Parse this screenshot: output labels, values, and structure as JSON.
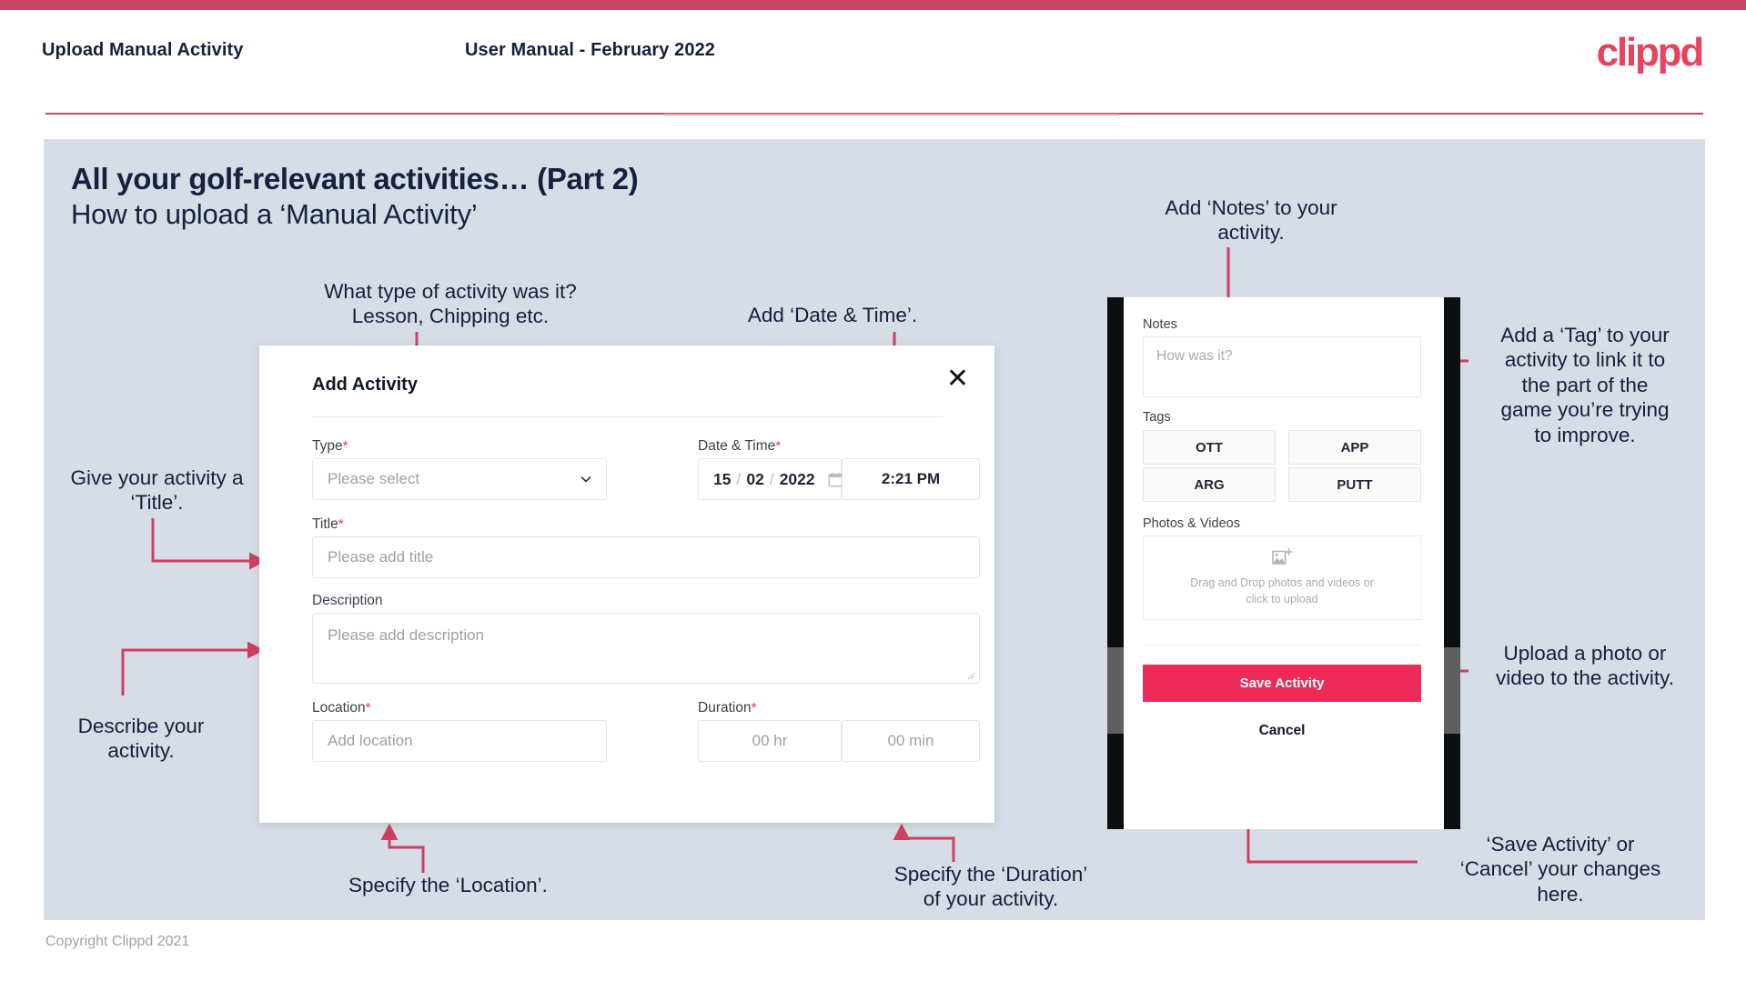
{
  "header": {
    "left_title": "Upload Manual Activity",
    "center_title": "User Manual - February 2022",
    "logo_text": "clippd"
  },
  "slide": {
    "title": "All your golf-relevant activities… (Part 2)",
    "subtitle": "How to upload a ‘Manual Activity’",
    "footer": "Copyright Clippd 2021"
  },
  "dialog": {
    "title": "Add Activity",
    "close_icon": "close-icon",
    "fields": {
      "type": {
        "label": "Type",
        "required": "*",
        "placeholder": "Please select",
        "chevron_icon": "chevron-down-icon"
      },
      "datetime": {
        "label": "Date & Time",
        "required": "*",
        "day": "15",
        "sep1": "/",
        "month": "02",
        "sep2": "/",
        "year": "2022",
        "calendar_icon": "calendar-icon",
        "time": "2:21 PM"
      },
      "title": {
        "label": "Title",
        "required": "*",
        "placeholder": "Please add title"
      },
      "description": {
        "label": "Description",
        "required": "",
        "placeholder": "Please add description"
      },
      "location": {
        "label": "Location",
        "required": "*",
        "placeholder": "Add location"
      },
      "duration": {
        "label": "Duration",
        "required": "*",
        "hours_placeholder": "00 hr",
        "minutes_placeholder": "00 min"
      }
    }
  },
  "phone": {
    "notes": {
      "label": "Notes",
      "placeholder": "How was it?"
    },
    "tags": {
      "label": "Tags",
      "items": [
        "OTT",
        "APP",
        "ARG",
        "PUTT"
      ]
    },
    "photos": {
      "label": "Photos & Videos",
      "upload_icon": "add-image-icon",
      "dropzone_line1": "Drag and Drop photos and videos or",
      "dropzone_line2": "click to upload"
    },
    "save_label": "Save Activity",
    "cancel_label": "Cancel"
  },
  "annotations": {
    "type": "What type of activity was it?\nLesson, Chipping etc.",
    "datetime": "Add ‘Date & Time’.",
    "title": "Give your activity a\n‘Title’.",
    "description": "Describe your\nactivity.",
    "location": "Specify the ‘Location’.",
    "duration": "Specify the ‘Duration’\nof your activity.",
    "notes": "Add ‘Notes’ to your\nactivity.",
    "tags": "Add a ‘Tag’ to your\nactivity to link it to\nthe part of the\ngame you’re trying\nto improve.",
    "photos": "Upload a photo or\nvideo to the activity.",
    "save_cancel": "‘Save Activity’ or\n‘Cancel’ your changes\nhere."
  },
  "colors": {
    "accent_bar": "#c74862",
    "brand": "#e8425f",
    "slide_bg": "#d7dde6",
    "annotation_line": "#cf4060",
    "save_button": "#ec2b58",
    "required_star": "#f0325a",
    "text_dark": "#141f3d"
  }
}
